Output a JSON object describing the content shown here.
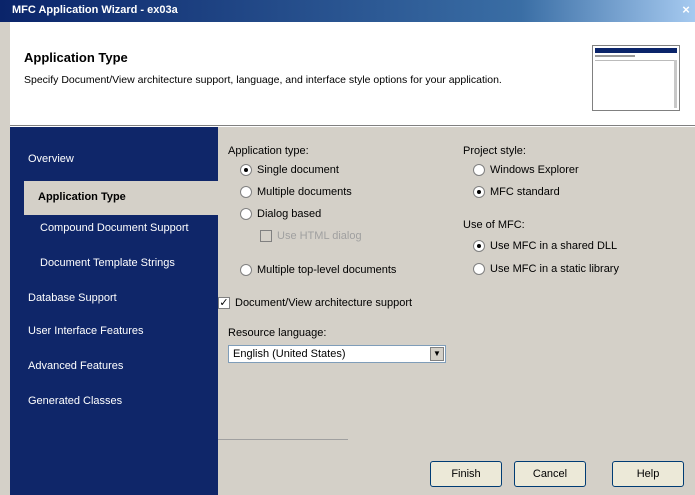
{
  "window": {
    "title": "MFC Application Wizard - ex03a",
    "close_glyph": "×"
  },
  "header": {
    "title": "Application Type",
    "description": "Specify Document/View architecture support, language, and interface style options for your application."
  },
  "nav": {
    "items": [
      {
        "label": "Overview"
      },
      {
        "label": "Application Type"
      },
      {
        "label": "Compound Document Support"
      },
      {
        "label": "Document Template Strings"
      },
      {
        "label": "Database Support"
      },
      {
        "label": "User Interface Features"
      },
      {
        "label": "Advanced Features"
      },
      {
        "label": "Generated Classes"
      }
    ],
    "selected": "Application Type"
  },
  "app_type": {
    "label": "Application type:",
    "options": [
      {
        "label": "Single document",
        "selected": true
      },
      {
        "label": "Multiple documents",
        "selected": false
      },
      {
        "label": "Dialog based",
        "selected": false
      }
    ],
    "tabbed_label": "Use HTML dialog",
    "multiple_top_level": "Multiple top-level documents",
    "doc_view_support": "Document/View architecture support",
    "doc_view_checked": true
  },
  "project_style": {
    "label": "Project style:",
    "options": [
      {
        "label": "Windows Explorer",
        "selected": false
      },
      {
        "label": "MFC standard",
        "selected": true
      }
    ]
  },
  "use_of_mfc": {
    "label": "Use of MFC:",
    "options": [
      {
        "label": "Use MFC in a shared DLL",
        "selected": true
      },
      {
        "label": "Use MFC in a static library",
        "selected": false
      }
    ]
  },
  "resource_language": {
    "label": "Resource language:",
    "value": "English (United States)"
  },
  "buttons": {
    "finish": "Finish",
    "cancel": "Cancel",
    "help": "Help"
  },
  "colors": {
    "nav_bg": "#0f2669",
    "dialog_bg": "#d4d0c8",
    "title_bar": "#0a246a"
  }
}
